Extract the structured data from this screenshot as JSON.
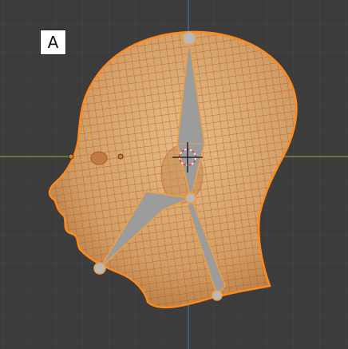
{
  "viewport": {
    "annotation_label": "A",
    "colors": {
      "background": "#3c3c3c",
      "grid": "#464646",
      "x_axis": "#7e9a35",
      "z_axis": "#3e6b99",
      "mesh_fill": "#d2a06a",
      "mesh_wire": "#b2561a",
      "selection_outline": "#ff8a1e",
      "bone_fill": "#9c9c9c",
      "bone_outline": "#f0a040",
      "cursor_ring": "#d83a3a"
    },
    "objects": {
      "mesh": "head-mesh",
      "armature_bones": 3,
      "cursor": "3d-cursor",
      "origin": "object-origin"
    }
  }
}
